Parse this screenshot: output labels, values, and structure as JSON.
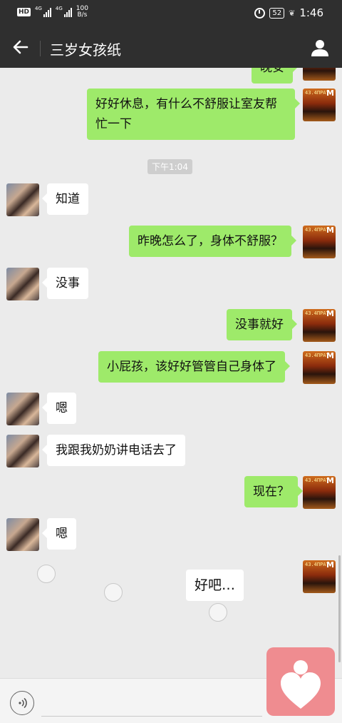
{
  "status_bar": {
    "network_1": "4G",
    "network_2": "4G",
    "speed_value": "100",
    "speed_unit": "B/s",
    "battery": "52",
    "time": "1:46",
    "hd_label": "HD"
  },
  "navbar": {
    "title": "三岁女孩纸"
  },
  "chat": {
    "partial_top_text": "晚安",
    "timestamp": "下午1:04",
    "messages": [
      {
        "from": "me",
        "text_line1": "好好休息，有什么不舒服让室友帮",
        "text_line2": "忙一下"
      },
      {
        "from": "other",
        "text": "知道"
      },
      {
        "from": "me",
        "text": "昨晚怎么了，身体不舒服？"
      },
      {
        "from": "other",
        "text": "没事"
      },
      {
        "from": "me",
        "text": "没事就好"
      },
      {
        "from": "me",
        "text": "小屁孩，该好好管管自己身体了"
      },
      {
        "from": "other",
        "text": "嗯"
      },
      {
        "from": "other",
        "text": "我跟我奶奶讲电话去了"
      },
      {
        "from": "me",
        "text": "现在？"
      },
      {
        "from": "other",
        "text": "嗯"
      },
      {
        "from": "me",
        "text": "好吧…"
      }
    ]
  },
  "avatar_me_text": "M",
  "avatar_me_small": "43.4ПРАТ",
  "colors": {
    "bar_bg": "#2f2f2f",
    "chat_bg": "#ebebeb",
    "my_bubble": "#9eea6a",
    "other_bubble": "#ffffff",
    "float_heart_bg": "#ef8c90"
  },
  "icons": {
    "back": "arrow-left-icon",
    "contact": "person-icon",
    "voice": "voice-icon",
    "float": "heart-icon"
  }
}
